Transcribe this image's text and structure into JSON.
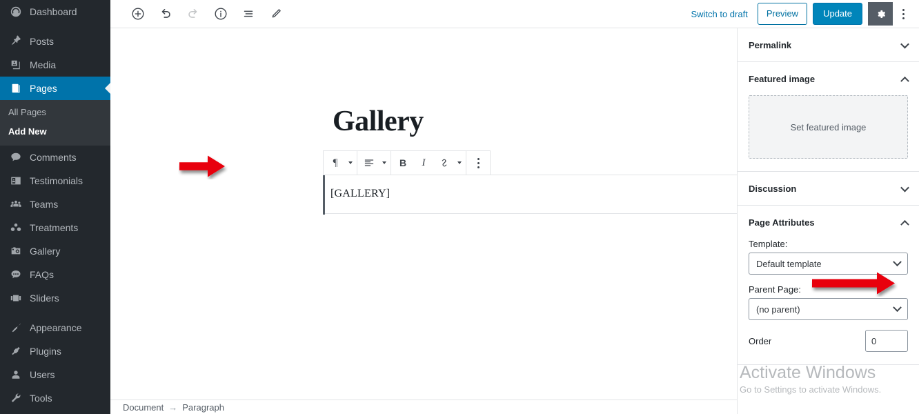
{
  "admin_menu": {
    "items": [
      {
        "label": "Dashboard",
        "icon": "dashboard-icon",
        "current": false
      },
      {
        "label": "Posts",
        "icon": "pin-icon",
        "current": false
      },
      {
        "label": "Media",
        "icon": "media-icon",
        "current": false
      },
      {
        "label": "Pages",
        "icon": "pages-icon",
        "current": true
      },
      {
        "label": "Comments",
        "icon": "comment-bubble-icon",
        "current": false
      },
      {
        "label": "Testimonials",
        "icon": "id-card-icon",
        "current": false
      },
      {
        "label": "Teams",
        "icon": "groups-icon",
        "current": false
      },
      {
        "label": "Treatments",
        "icon": "users-dots-icon",
        "current": false
      },
      {
        "label": "Gallery",
        "icon": "camera-icon",
        "current": false
      },
      {
        "label": "FAQs",
        "icon": "chat-bubble-icon",
        "current": false
      },
      {
        "label": "Sliders",
        "icon": "slides-icon",
        "current": false
      },
      {
        "label": "Appearance",
        "icon": "paintbrush-icon",
        "current": false
      },
      {
        "label": "Plugins",
        "icon": "plug-icon",
        "current": false
      },
      {
        "label": "Users",
        "icon": "user-icon",
        "current": false
      },
      {
        "label": "Tools",
        "icon": "wrench-icon",
        "current": false
      }
    ],
    "pages_submenu": [
      {
        "label": "All Pages",
        "current": false
      },
      {
        "label": "Add New",
        "current": true
      }
    ]
  },
  "header": {
    "tools": [
      {
        "name": "add-block-button",
        "icon": "plus-circle-icon",
        "disabled": false
      },
      {
        "name": "undo-button",
        "icon": "undo-icon",
        "disabled": false
      },
      {
        "name": "redo-button",
        "icon": "redo-icon",
        "disabled": true
      },
      {
        "name": "content-info-button",
        "icon": "info-circle-icon",
        "disabled": false
      },
      {
        "name": "block-navigation-button",
        "icon": "list-view-icon",
        "disabled": false
      },
      {
        "name": "edit-mode-button",
        "icon": "pencil-icon",
        "disabled": false
      }
    ],
    "switch_to_draft": "Switch to draft",
    "preview_label": "Preview",
    "update_label": "Update",
    "settings_icon": "gear-icon",
    "more_menu_icon": "vertical-ellipsis-icon",
    "accent_blue": "#0085ba",
    "link_blue": "#0073aa"
  },
  "editor": {
    "post_title": "Gallery",
    "paragraph_text": "[GALLERY]",
    "block_toolbar": {
      "block_type_icon": "paragraph-icon",
      "block_type_glyph": "¶",
      "align_icon": "align-left-icon",
      "bold_label": "B",
      "italic_label": "I",
      "link_icon": "link-icon",
      "more_rich_text_icon": "chevron-down-icon",
      "block_options_icon": "vertical-ellipsis-icon"
    },
    "breadcrumb": {
      "document": "Document",
      "separator": "→",
      "block": "Paragraph"
    }
  },
  "inspector": {
    "panels": [
      {
        "title": "Permalink",
        "expanded": false
      },
      {
        "title": "Featured image",
        "expanded": true
      },
      {
        "title": "Discussion",
        "expanded": false
      },
      {
        "title": "Page Attributes",
        "expanded": true
      }
    ],
    "featured_image": {
      "placeholder": "Set featured image"
    },
    "page_attributes": {
      "template_label": "Template:",
      "template_value": "Default template",
      "parent_label": "Parent Page:",
      "parent_value": "(no parent)",
      "order_label": "Order",
      "order_value": "0"
    }
  },
  "watermark": {
    "line1": "Activate Windows",
    "line2": "Go to Settings to activate Windows."
  },
  "annotations": {
    "arrow_color": "#e8000d",
    "arrow_gallery_target": "paragraph-block-text",
    "arrow_template_target": "template-select"
  }
}
